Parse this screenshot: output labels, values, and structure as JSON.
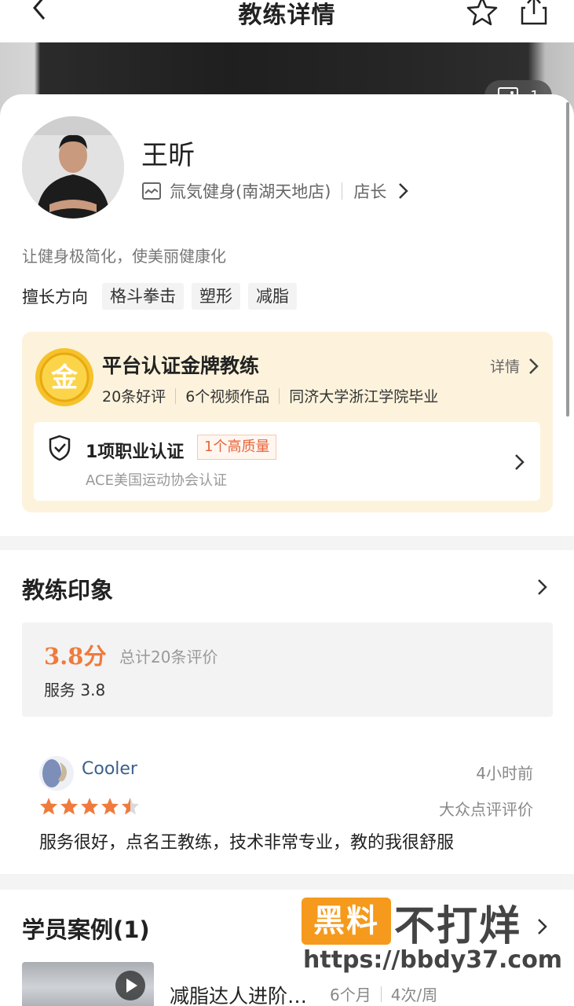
{
  "header": {
    "title": "教练详情"
  },
  "banner": {
    "photo_count": "1"
  },
  "coach": {
    "name": "王昕",
    "store": "氚気健身(南湖天地店)",
    "role": "店长",
    "slogan": "让健身极简化，使美丽健康化",
    "skills_label": "擅长方向",
    "skills": [
      "格斗拳击",
      "塑形",
      "减脂"
    ]
  },
  "gold": {
    "medal_char": "金",
    "title": "平台认证金牌教练",
    "detail_label": "详情",
    "stats": [
      "20条好评",
      "6个视频作品",
      "同济大学浙江学院毕业"
    ],
    "cert_title": "1项职业认证",
    "cert_badge": "1个高质量",
    "cert_sub": "ACE美国运动协会认证"
  },
  "impression": {
    "title": "教练印象",
    "score": "3.8分",
    "total": "总计20条评价",
    "service": "服务 3.8",
    "rating": 4.5,
    "review": {
      "user": "Cooler",
      "time": "4小时前",
      "source": "大众点评评价",
      "text": "服务很好，点名王教练，技术非常专业，教的我很舒服"
    }
  },
  "cases": {
    "title": "学员案例(1)",
    "item": {
      "title": "减脂达人进阶…",
      "duration": "6个月",
      "frequency": "4次/周"
    }
  },
  "watermark": {
    "box": "黑料",
    "big": "不打烊",
    "url": "https://bbdy37.com"
  },
  "colors": {
    "accent": "#f07a3c",
    "gold_bg": "#fdf3dc",
    "star": "#f07a3c",
    "watermark": "#f59a1c"
  }
}
